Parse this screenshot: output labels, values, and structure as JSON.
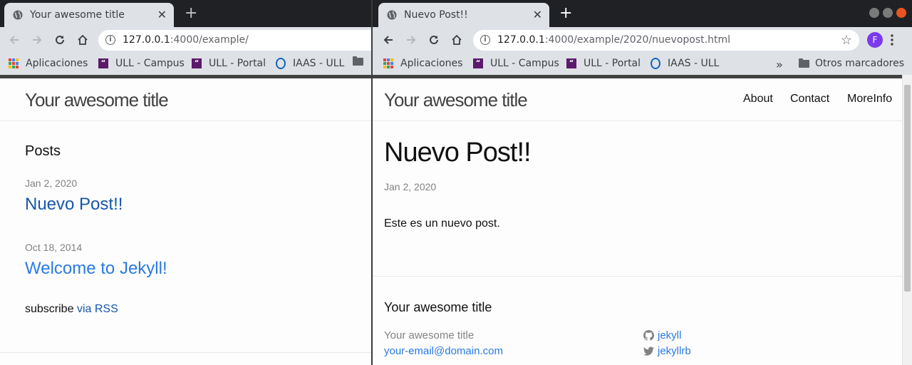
{
  "left_window": {
    "tab_title": "Your awesome title",
    "url_host": "127.0.0.1",
    "url_path": ":4000/example/",
    "bookmarks": [
      "Aplicaciones",
      "ULL - Campus",
      "ULL - Portal",
      "IAAS - ULL"
    ],
    "page": {
      "site_title": "Your awesome title",
      "posts_heading": "Posts",
      "posts": [
        {
          "date": "Jan 2, 2020",
          "title": "Nuevo Post!!"
        },
        {
          "date": "Oct 18, 2014",
          "title": "Welcome to Jekyll!"
        }
      ],
      "subscribe_label": "subscribe",
      "subscribe_link": "via RSS"
    }
  },
  "right_window": {
    "tab_title": "Nuevo Post!!",
    "url_host": "127.0.0.1",
    "url_path": ":4000/example/2020/nuevopost.html",
    "profile_initial": "F",
    "bookmarks": [
      "Aplicaciones",
      "ULL - Campus",
      "ULL - Portal",
      "IAAS - ULL"
    ],
    "bookmarks_overflow": "»",
    "other_bookmarks": "Otros marcadores",
    "page": {
      "site_title": "Your awesome title",
      "nav": [
        "About",
        "Contact",
        "MoreInfo"
      ],
      "post_title": "Nuevo Post!!",
      "post_date": "Jan 2, 2020",
      "post_body": "Este es un nuevo post.",
      "footer_heading": "Your awesome title",
      "footer_name": "Your awesome title",
      "footer_email": "your-email@domain.com",
      "footer_github": "jekyll",
      "footer_twitter": "jekyllrb"
    }
  },
  "colors": {
    "link": "#2a7ae2",
    "visited_link": "#1756a9",
    "ull_purple": "#5b1a6b",
    "profile": "#7c3aed"
  }
}
